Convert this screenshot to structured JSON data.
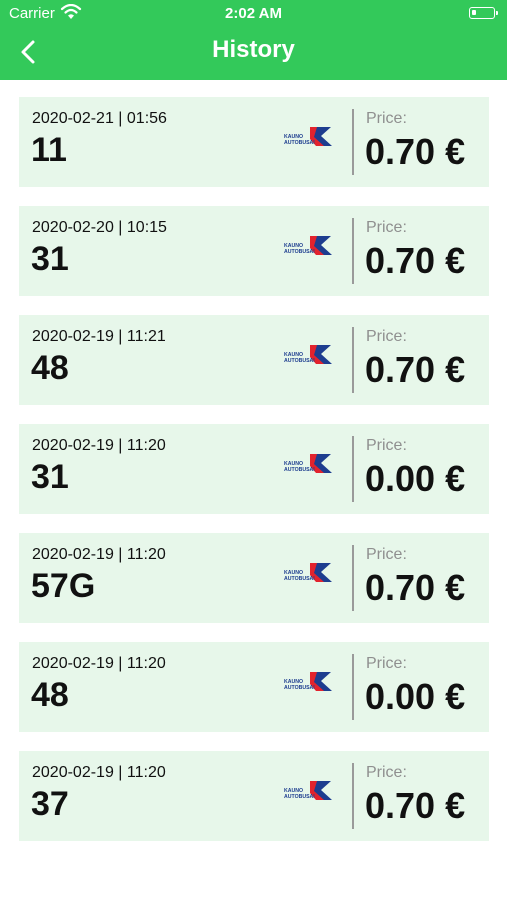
{
  "status_bar": {
    "carrier": "Carrier",
    "time": "2:02 AM"
  },
  "header": {
    "title": "History"
  },
  "history": {
    "price_label": "Price:",
    "items": [
      {
        "date": "2020-02-21 | 01:56",
        "route": "11",
        "price": "0.70 €"
      },
      {
        "date": "2020-02-20 | 10:15",
        "route": "31",
        "price": "0.70 €"
      },
      {
        "date": "2020-02-19 | 11:21",
        "route": "48",
        "price": "0.70 €"
      },
      {
        "date": "2020-02-19 | 11:20",
        "route": "31",
        "price": "0.00 €"
      },
      {
        "date": "2020-02-19 | 11:20",
        "route": "57G",
        "price": "0.70 €"
      },
      {
        "date": "2020-02-19 | 11:20",
        "route": "48",
        "price": "0.00 €"
      },
      {
        "date": "2020-02-19 | 11:20",
        "route": "37",
        "price": "0.70 €"
      }
    ],
    "logo_text": [
      "KAUNO",
      "AUTOBUSAI"
    ]
  },
  "colors": {
    "header": "#33c95a",
    "card": "#e7f7ea",
    "logo_red": "#e2232d",
    "logo_blue": "#1d3d8f"
  },
  "icons": {
    "back": "chevron-left-icon",
    "wifi": "wifi-icon",
    "battery": "battery-icon"
  }
}
